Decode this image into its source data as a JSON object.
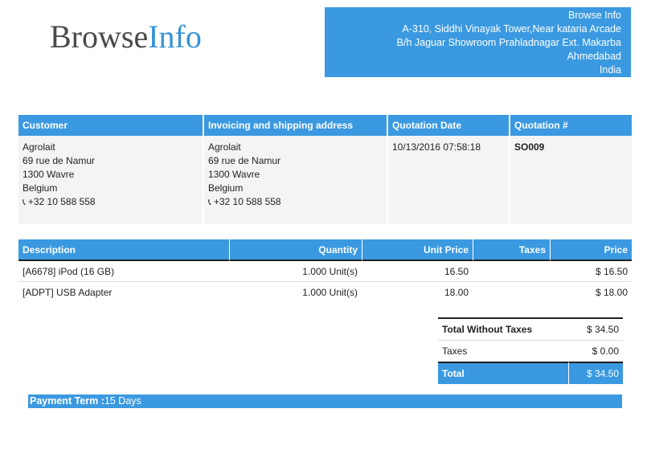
{
  "logo": {
    "part1": "Browse",
    "part2": "Info"
  },
  "company": {
    "lines": [
      "Browse Info",
      "A-310, Siddhi Vinayak Tower,Near kataria Arcade",
      "B/h Jaguar Showroom Prahladnagar Ext. Makarba",
      "Ahmedabad",
      "India"
    ]
  },
  "info_table": {
    "headers": [
      "Customer",
      "Invoicing and shipping address",
      "Quotation Date",
      "Quotation #"
    ],
    "customer": {
      "name": "Agrolait",
      "street": "69 rue de Namur",
      "city": "1300 Wavre",
      "country": "Belgium",
      "phone": "+32 10 588 558"
    },
    "shipping": {
      "name": "Agrolait",
      "street": "69 rue de Namur",
      "city": "1300 Wavre",
      "country": "Belgium",
      "phone": "+32 10 588 558"
    },
    "quotation_date": "10/13/2016 07:58:18",
    "quotation_number": "SO009"
  },
  "order_lines": {
    "headers": [
      "Description",
      "Quantity",
      "Unit Price",
      "Taxes",
      "Price"
    ],
    "rows": [
      {
        "description": "[A6678] iPod (16 GB)",
        "quantity": "1.000 Unit(s)",
        "unit_price": "16.50",
        "taxes": "",
        "price": "$ 16.50"
      },
      {
        "description": "[ADPT] USB Adapter",
        "quantity": "1.000 Unit(s)",
        "unit_price": "18.00",
        "taxes": "",
        "price": "$ 18.00"
      }
    ]
  },
  "totals": {
    "subtotal_label": "Total Without Taxes",
    "subtotal_value": "$ 34.50",
    "taxes_label": "Taxes",
    "taxes_value": "$ 0.00",
    "total_label": "Total",
    "total_value": "$ 34.50"
  },
  "payment": {
    "label": "Payment Term :",
    "value": "15 Days"
  },
  "icons": {
    "phone": "phone-icon"
  },
  "colors": {
    "accent": "#3a99e0",
    "logo_dark": "#4a4a4a",
    "logo_blue": "#3592d3"
  }
}
